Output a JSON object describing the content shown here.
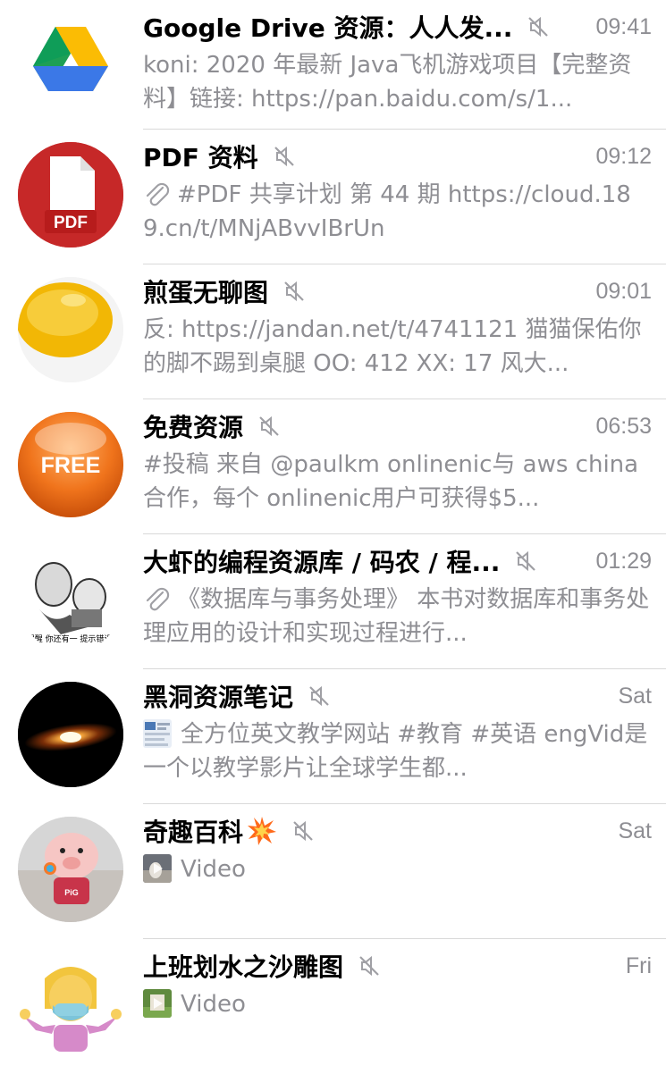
{
  "chats": [
    {
      "title": "Google Drive 资源：人人发...",
      "time": "09:41",
      "preview": "koni: 2020 年最新 Java飞机游戏项目【完整资料】链接: https://pan.baidu.com/s/1...",
      "avatar": "google-drive-logo"
    },
    {
      "title": "PDF 资料",
      "time": "09:12",
      "preview": "#PDF 共享计划  第 44 期 https://cloud.189.cn/t/MNjABvvIBrUn",
      "avatar": "pdf-logo",
      "avatar_label": "PDF",
      "preview_icon": "paperclip-icon"
    },
    {
      "title": "煎蛋无聊图",
      "time": "09:01",
      "preview": "反: https://jandan.net/t/4741121 猫猫保佑你的脚不踢到桌腿 OO: 412 XX: 17 风大...",
      "avatar": "fried-egg-yolk"
    },
    {
      "title": "免费资源",
      "time": "06:53",
      "preview": "#投稿 来自 @paulkm onlinenic与 aws china合作，每个 onlinenic用户可获得$5...",
      "avatar": "free-orange-button",
      "avatar_label": "FREE"
    },
    {
      "title": "大虾的编程资源库 / 码农 / 程...",
      "time": "01:29",
      "preview": "《数据库与事务处理》 本书对数据库和事务处理应用的设计和实现过程进行...",
      "avatar": "meme-faces",
      "avatar_label": "志快醒醒 你还有一 提示错误 起来",
      "preview_icon": "paperclip-icon"
    },
    {
      "title": "黑洞资源笔记",
      "time": "Sat",
      "preview": "全方位英文教学网站 #教育 #英语 engVid是一个以教学影片让全球学生都...",
      "avatar": "galaxy",
      "preview_icon": "website-thumbnail"
    },
    {
      "title": "奇趣百科",
      "title_emoji": "collision-icon",
      "time": "Sat",
      "preview": "Video",
      "avatar": "pig-cartoon",
      "avatar_label": "PiG",
      "preview_icon": "video-thumbnail"
    },
    {
      "title": "上班划水之沙雕图",
      "time": "Fri",
      "preview": "Video",
      "avatar": "shrugging-woman-mask-emoji",
      "preview_icon": "video-thumbnail"
    }
  ],
  "colors": {
    "title": "#000000",
    "secondary": "#8e8e93",
    "divider": "#d9d9d9",
    "mute_icon": "#a0a0a5"
  }
}
